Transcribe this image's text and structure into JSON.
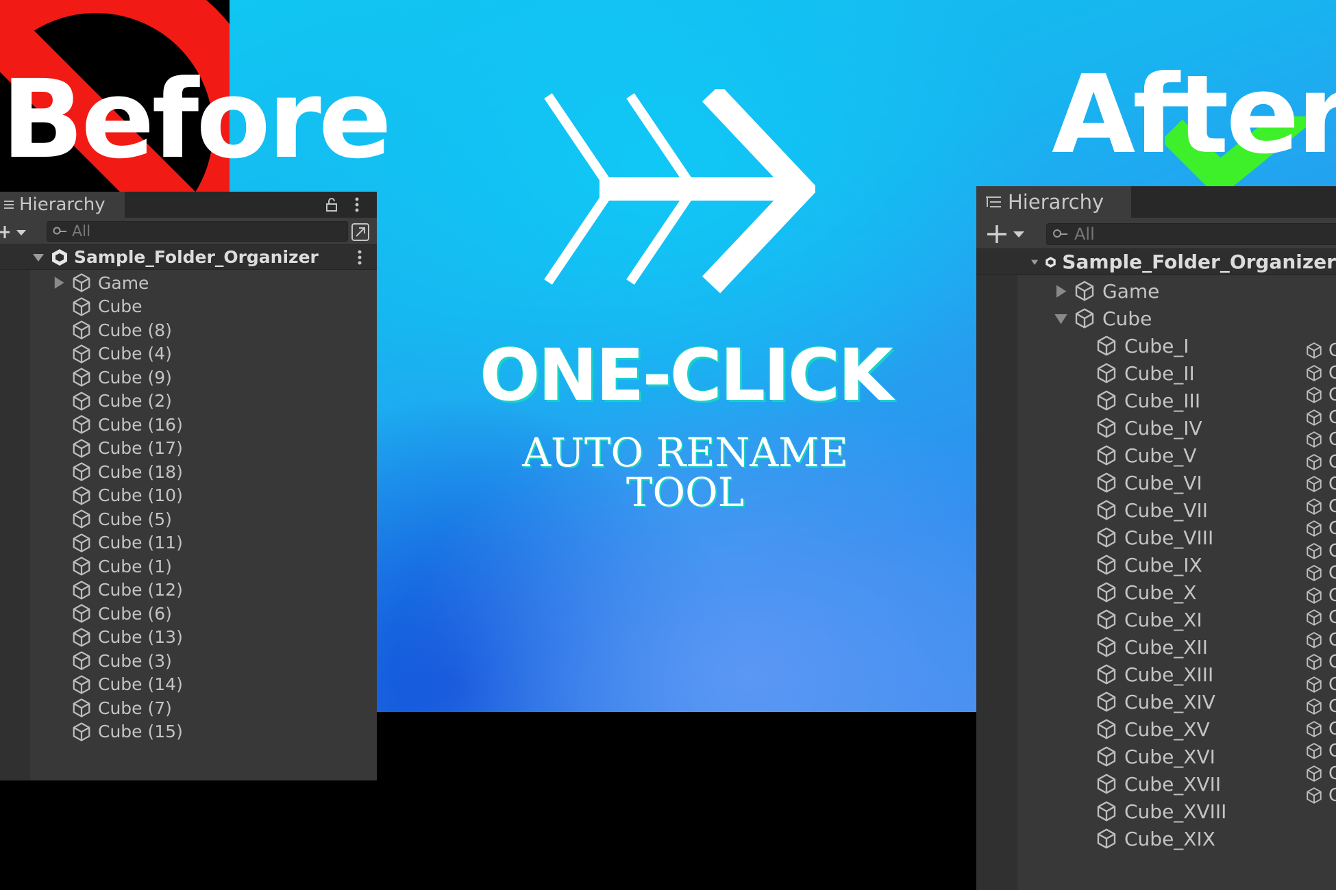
{
  "banner": {
    "before_title": "Before",
    "after_title": "After",
    "headline": "ONE-CLICK",
    "subtitle_line1": "AUTO RENAME",
    "subtitle_line2": "TOOL",
    "arrow_icon": "triple-chevron-arrow-icon",
    "no_sign_icon": "prohibited-icon",
    "check_icon": "checkmark-icon"
  },
  "colors": {
    "prohibit_red": "#f21a14",
    "check_green": "#3ef02a",
    "bg_cyan": "#10c6f2",
    "bg_blue": "#2f8fef",
    "panel_bg": "#383838",
    "headline_outline": "#19d2c8"
  },
  "before_panel": {
    "tab_title": "Hierarchy",
    "search_placeholder": "All",
    "scene_name": "Sample_Folder_Organizer",
    "items": [
      {
        "label": "Game",
        "expandable": true
      },
      {
        "label": "Cube"
      },
      {
        "label": "Cube (8)"
      },
      {
        "label": "Cube (4)"
      },
      {
        "label": "Cube (9)"
      },
      {
        "label": "Cube (2)"
      },
      {
        "label": "Cube (16)"
      },
      {
        "label": "Cube (17)"
      },
      {
        "label": "Cube (18)"
      },
      {
        "label": "Cube (10)"
      },
      {
        "label": "Cube (5)"
      },
      {
        "label": "Cube (11)"
      },
      {
        "label": "Cube (1)"
      },
      {
        "label": "Cube (12)"
      },
      {
        "label": "Cube (6)"
      },
      {
        "label": "Cube (13)"
      },
      {
        "label": "Cube (3)"
      },
      {
        "label": "Cube (14)"
      },
      {
        "label": "Cube (7)"
      },
      {
        "label": "Cube (15)"
      }
    ]
  },
  "after_panel": {
    "tab_title": "Hierarchy",
    "search_placeholder": "All",
    "scene_name": "Sample_Folder_Organizer",
    "game_label": "Game",
    "cube_parent_label": "Cube",
    "children": [
      "Cube_I",
      "Cube_II",
      "Cube_III",
      "Cube_IV",
      "Cube_V",
      "Cube_VI",
      "Cube_VII",
      "Cube_VIII",
      "Cube_IX",
      "Cube_X",
      "Cube_XI",
      "Cube_XII",
      "Cube_XIII",
      "Cube_XIV",
      "Cube_XV",
      "Cube_XVI",
      "Cube_XVII",
      "Cube_XVIII",
      "Cube_XIX"
    ],
    "cut_column_glyph": "C"
  }
}
